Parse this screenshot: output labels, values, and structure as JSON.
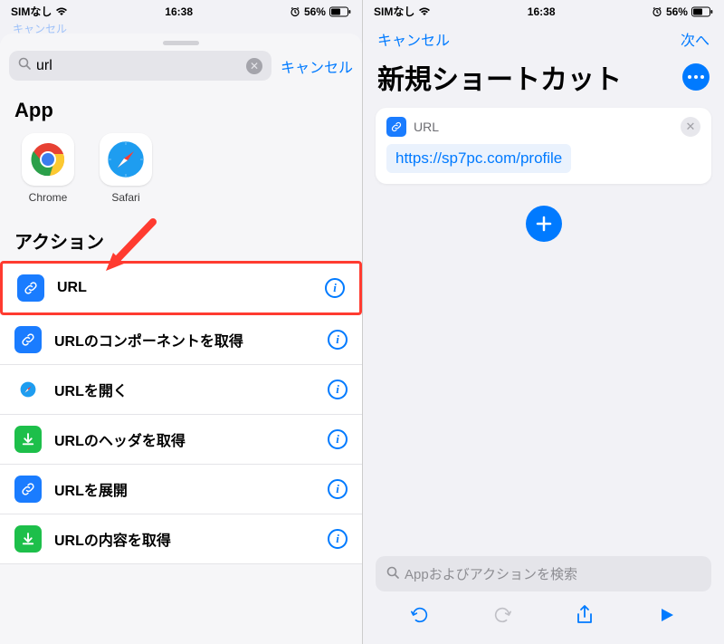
{
  "status": {
    "carrier": "SIMなし",
    "time": "16:38",
    "battery_pct": "56%"
  },
  "left": {
    "faint_cancel": "キャンセル",
    "search_value": "url",
    "cancel": "キャンセル",
    "app_header": "App",
    "apps": [
      {
        "name": "Chrome"
      },
      {
        "name": "Safari"
      }
    ],
    "action_header": "アクション",
    "actions": [
      {
        "label": "URL",
        "icon": "link",
        "bg": "#1a7cff",
        "highlighted": true
      },
      {
        "label": "URLのコンポーネントを取得",
        "icon": "link",
        "bg": "#1a7cff"
      },
      {
        "label": "URLを開く",
        "icon": "safari",
        "bg": "transparent"
      },
      {
        "label": "URLのヘッダを取得",
        "icon": "download",
        "bg": "#1dbf4a"
      },
      {
        "label": "URLを展開",
        "icon": "link",
        "bg": "#1a7cff"
      },
      {
        "label": "URLの内容を取得",
        "icon": "download",
        "bg": "#1dbf4a"
      }
    ]
  },
  "right": {
    "nav_cancel": "キャンセル",
    "nav_next": "次へ",
    "title": "新規ショートカット",
    "card_label": "URL",
    "url_text": "https://sp7pc.com/profile",
    "search_placeholder": "Appおよびアクションを検索"
  }
}
